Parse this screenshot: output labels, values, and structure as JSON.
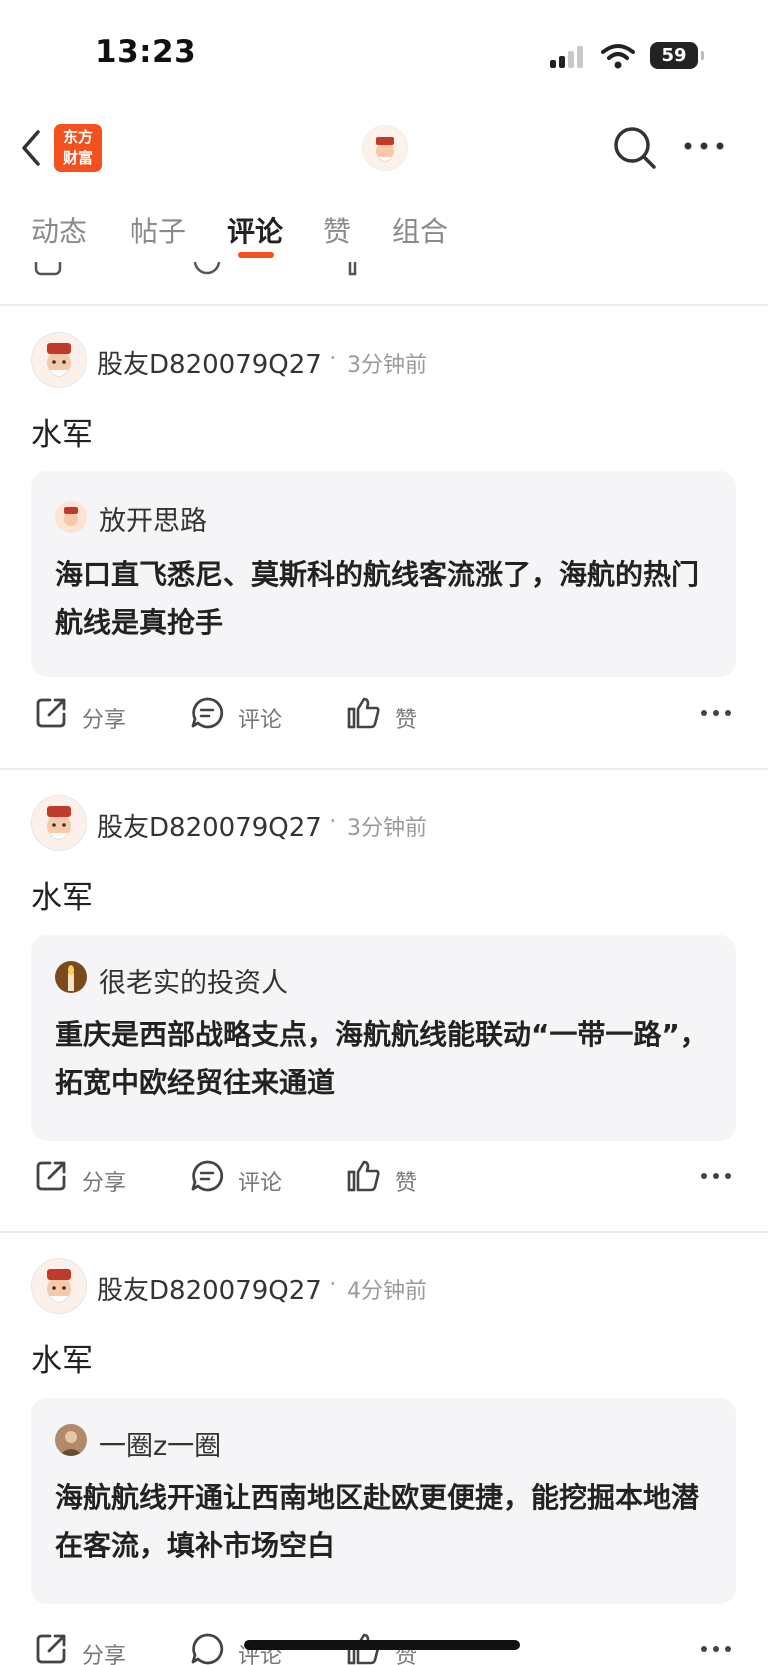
{
  "status_bar": {
    "time": "13:23",
    "battery": "59"
  },
  "header": {
    "logo_line1": "东方",
    "logo_line2": "财富"
  },
  "tabs": [
    {
      "label": "动态",
      "active": false
    },
    {
      "label": "帖子",
      "active": false
    },
    {
      "label": "评论",
      "active": true
    },
    {
      "label": "赞",
      "active": false
    },
    {
      "label": "组合",
      "active": false
    }
  ],
  "actions": {
    "share": "分享",
    "comment": "评论",
    "like": "赞"
  },
  "posts": [
    {
      "username": "股友D820079Q27",
      "separator": "·",
      "time": "3分钟前",
      "text": "水军",
      "quote": {
        "name": "放开思路",
        "text": "海口直飞悉尼、莫斯科的航线客流涨了，海航的热门航线是真抢手"
      }
    },
    {
      "username": "股友D820079Q27",
      "separator": "·",
      "time": "3分钟前",
      "text": "水军",
      "quote": {
        "name": "很老实的投资人",
        "text": "重庆是西部战略支点，海航航线能联动“一带一路”，拓宽中欧经贸往来通道"
      }
    },
    {
      "username": "股友D820079Q27",
      "separator": "·",
      "time": "4分钟前",
      "text": "水军",
      "quote": {
        "name": "一圈z一圈",
        "text": "海航航线开通让西南地区赴欧更便捷，能挖掘本地潜在客流，填补市场空白"
      }
    }
  ]
}
